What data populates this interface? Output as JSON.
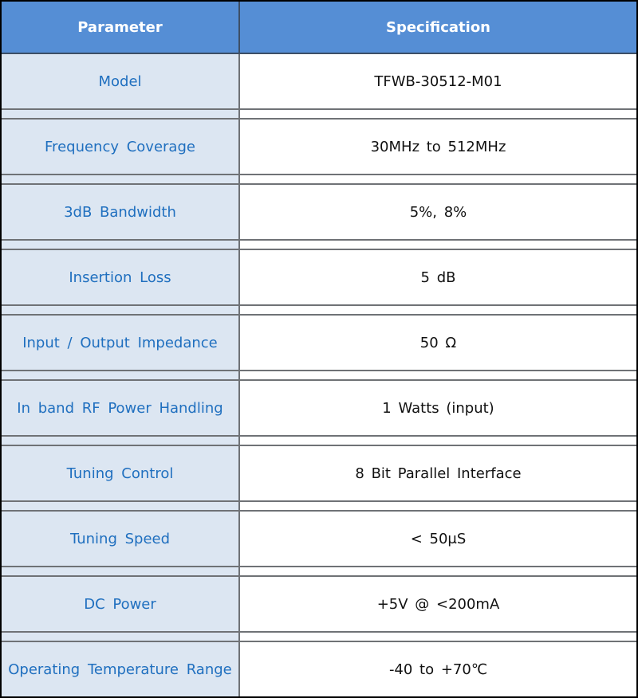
{
  "table": {
    "headers": [
      "Parameter",
      "Specification"
    ],
    "rows": [
      {
        "parameter": "Model",
        "specification": "TFWB-30512-M01"
      },
      {
        "parameter": "Frequency  Coverage",
        "specification": "30MHz to 512MHz"
      },
      {
        "parameter": "3dB Bandwidth",
        "specification": "5%,     8%"
      },
      {
        "parameter": "Insertion Loss",
        "specification": "5 dB"
      },
      {
        "parameter": "Input / Output Impedance",
        "specification": "50 Ω"
      },
      {
        "parameter": "In band RF Power Handling",
        "specification": "1 Watts (input)"
      },
      {
        "parameter": "Tuning Control",
        "specification": "8 Bit Parallel Interface"
      },
      {
        "parameter": "Tuning Speed",
        "specification": "< 50μS"
      },
      {
        "parameter": "DC Power",
        "specification": "+5V @ <200mA"
      },
      {
        "parameter": "Operating Temperature Range",
        "specification": "-40 to +70℃"
      }
    ]
  },
  "colors": {
    "header_bg": "#558ed5",
    "parameter_bg": "#dce6f2",
    "parameter_text": "#1f6fbf"
  }
}
